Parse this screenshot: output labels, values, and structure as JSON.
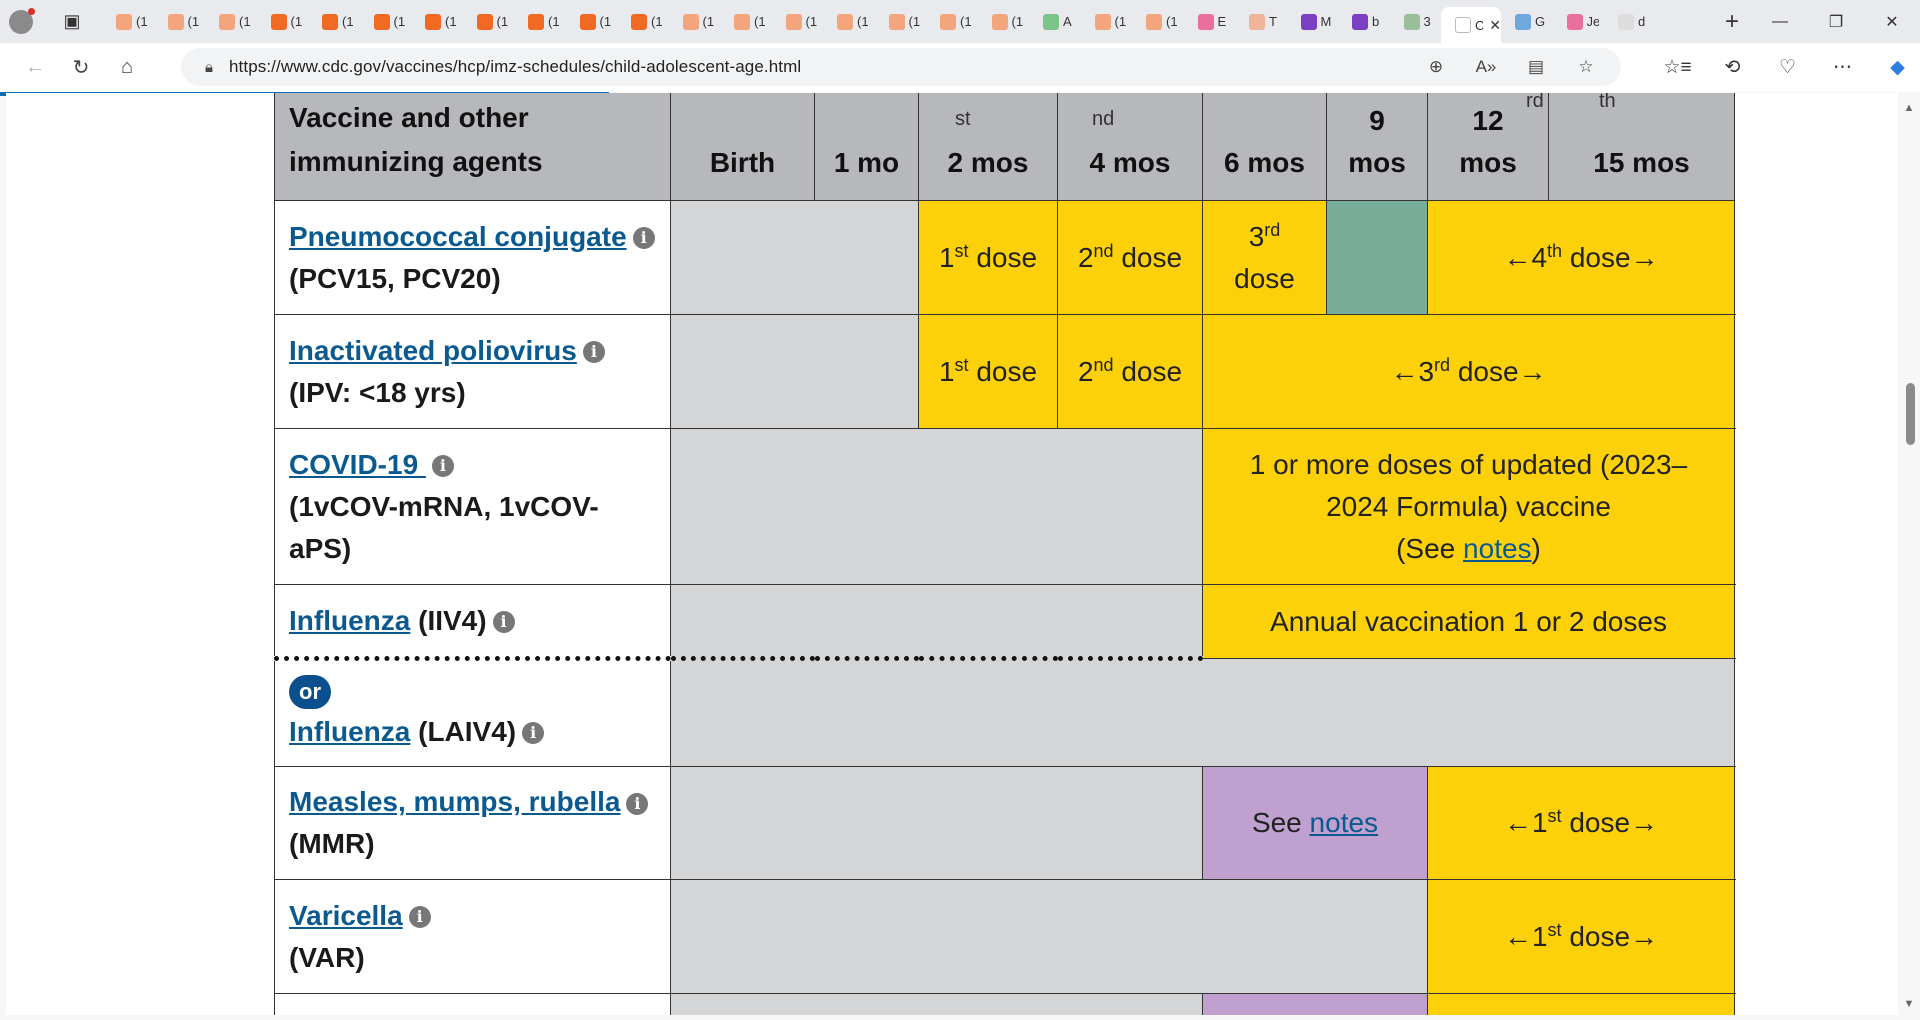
{
  "browser": {
    "tabs": [
      {
        "title": "(1",
        "icon": "bookmark-icon",
        "color": "#f3a57e"
      },
      {
        "title": "(1",
        "icon": "bookmark-icon",
        "color": "#f3a57e"
      },
      {
        "title": "(1",
        "icon": "bookmark-icon",
        "color": "#f3a57e"
      },
      {
        "title": "(1",
        "icon": "bookmark-icon",
        "color": "#f26a21"
      },
      {
        "title": "(1",
        "icon": "bookmark-icon",
        "color": "#f26a21"
      },
      {
        "title": "(1",
        "icon": "bookmark-icon",
        "color": "#f26a21"
      },
      {
        "title": "(1",
        "icon": "bookmark-icon",
        "color": "#f26a21"
      },
      {
        "title": "(1",
        "icon": "bookmark-icon",
        "color": "#f26a21"
      },
      {
        "title": "(1",
        "icon": "bookmark-icon",
        "color": "#f26a21"
      },
      {
        "title": "(1",
        "icon": "bookmark-icon",
        "color": "#f26a21"
      },
      {
        "title": "(1",
        "icon": "bookmark-icon",
        "color": "#f26a21"
      },
      {
        "title": "(1",
        "icon": "bookmark-icon",
        "color": "#f3a57e"
      },
      {
        "title": "(1",
        "icon": "bookmark-icon",
        "color": "#f3a57e"
      },
      {
        "title": "(1",
        "icon": "bookmark-icon",
        "color": "#f3a57e"
      },
      {
        "title": "(1",
        "icon": "bookmark-icon",
        "color": "#f3a57e"
      },
      {
        "title": "(1",
        "icon": "bookmark-icon",
        "color": "#f3a57e"
      },
      {
        "title": "(1",
        "icon": "bookmark-icon",
        "color": "#f3a57e"
      },
      {
        "title": "(1",
        "icon": "bookmark-icon",
        "color": "#f3a57e"
      },
      {
        "title": "A",
        "icon": "play-icon",
        "color": "#7cc48a"
      },
      {
        "title": "(1",
        "icon": "bookmark-icon",
        "color": "#f3a57e"
      },
      {
        "title": "(1",
        "icon": "bookmark-icon",
        "color": "#f3a57e"
      },
      {
        "title": "E",
        "icon": "video-icon",
        "color": "#e8709a"
      },
      {
        "title": "T",
        "icon": "circle-icon",
        "color": "#f0b49a"
      },
      {
        "title": "M",
        "icon": "yahoo-icon",
        "color": "#7b3fc4"
      },
      {
        "title": "b",
        "icon": "yahoo-icon",
        "color": "#7b3fc4"
      },
      {
        "title": "3",
        "icon": "globe-icon",
        "color": "#9bbf9b"
      },
      {
        "title": "C",
        "icon": "page-icon",
        "color": "#ffffff",
        "active": true
      },
      {
        "title": "G",
        "icon": "translate-icon",
        "color": "#6fa8dc"
      },
      {
        "title": "Je",
        "icon": "video-icon",
        "color": "#e8709a"
      },
      {
        "title": "d",
        "icon": "search-icon",
        "color": "#dddddd"
      }
    ],
    "url": "https://www.cdc.gov/vaccines/hcp/imz-schedules/child-adolescent-age.html",
    "progress_fraction": 0.317
  },
  "table": {
    "header": {
      "agents": "Vaccine and other immunizing agents",
      "cols": [
        {
          "label": "Birth",
          "note": ""
        },
        {
          "label": "1 mo",
          "note": ""
        },
        {
          "label": "2 mos",
          "note": "st"
        },
        {
          "label": "4 mos",
          "note": "nd"
        },
        {
          "label": "6 mos",
          "note": ""
        },
        {
          "label": "9 mos",
          "note": ""
        },
        {
          "label": "12 mos",
          "note": "rd"
        },
        {
          "label": "15 mos",
          "note": "th"
        }
      ]
    },
    "rows": {
      "pcv": {
        "name": "Pneumococcal conjugate",
        "sub": "(PCV15, PCV20)",
        "dose1": "1",
        "dose1_sup": "st",
        "dose1_word": " dose",
        "dose2": "2",
        "dose2_sup": "nd",
        "dose2_word": " dose",
        "dose3": "3",
        "dose3_sup": "rd",
        "dose3_word": "dose",
        "dose4_pre": "←4",
        "dose4_sup": "th",
        "dose4_post": " dose→"
      },
      "ipv": {
        "name": "Inactivated poliovirus",
        "sub": "(IPV: <18 yrs)",
        "dose1": "1",
        "dose1_sup": "st",
        "dose1_word": " dose",
        "dose2": "2",
        "dose2_sup": "nd",
        "dose2_word": " dose",
        "dose3_pre": "←3",
        "dose3_sup": "rd",
        "dose3_post": " dose→"
      },
      "covid": {
        "name": "COVID-19 ",
        "sub": "(1vCOV-mRNA, 1vCOV-aPS)",
        "text1": "1 or more doses of updated (2023–2024 Formula) vaccine",
        "text2_pre": "(See ",
        "text2_link": "notes",
        "text2_post": ")"
      },
      "flu_iiv": {
        "name": "Influenza",
        "sub": " (IIV4)",
        "text": "Annual vaccination 1 or 2 doses"
      },
      "flu_or": "or",
      "flu_laiv": {
        "name": "Influenza",
        "sub": " (LAIV4)"
      },
      "mmr": {
        "name": "Measles, mumps, rubella",
        "sub": "(MMR)",
        "see": "See ",
        "see_link": "notes",
        "dose1_pre": "←1",
        "dose1_sup": "st",
        "dose1_post": " dose→"
      },
      "var": {
        "name": "Varicella",
        "sub": "(VAR)",
        "dose1_pre": "←1",
        "dose1_sup": "st",
        "dose1_post": " dose→"
      }
    }
  },
  "info_icon_glyph": "i",
  "colors": {
    "header": "#b6b8bb",
    "recommended": "#fdd10a",
    "catch_up": "#78ae99",
    "special": "#bfa0cf",
    "not_recommended": "#d4d5d7",
    "link": "#0b5a8f"
  }
}
